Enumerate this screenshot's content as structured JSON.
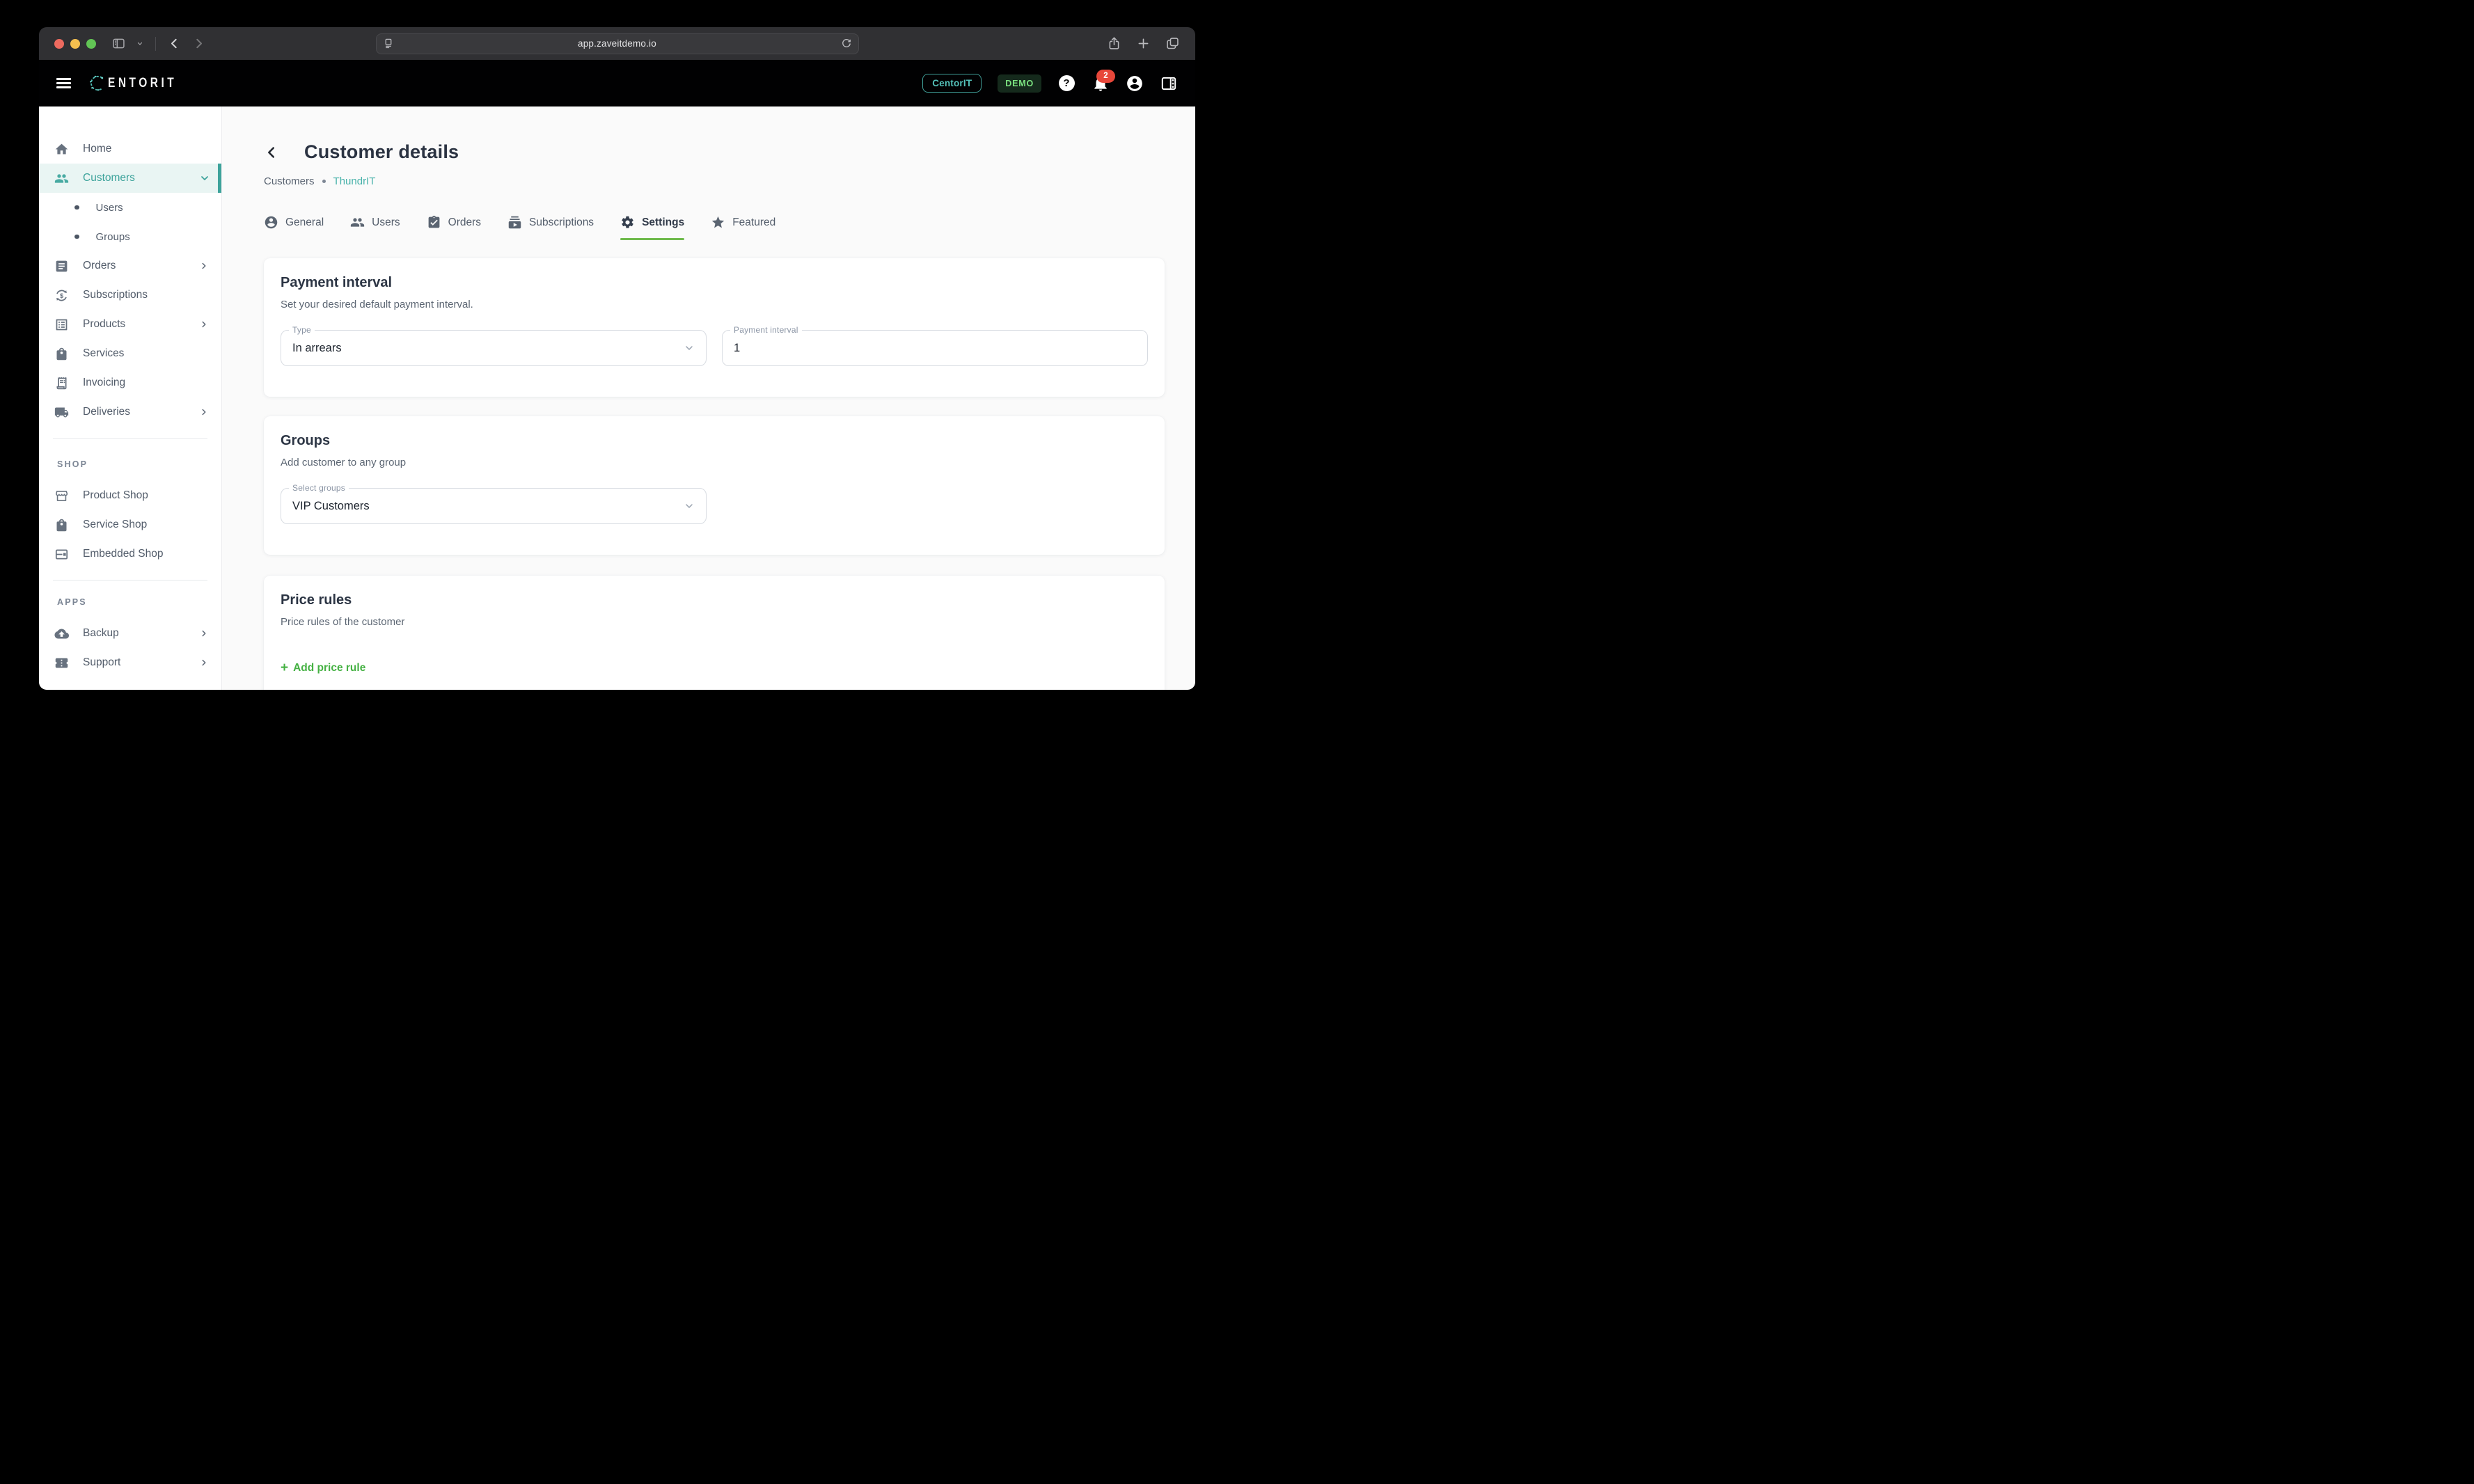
{
  "browser": {
    "url": "app.zaveitdemo.io"
  },
  "header": {
    "logo_mark_icon": "centorit-c-network-icon",
    "logo_text": "ENTORIT",
    "org_badge": "CentorIT",
    "env_badge": "DEMO",
    "help_icon": "help-icon",
    "bell_icon": "bell-icon",
    "notification_count": "2",
    "avatar_icon": "avatar-icon",
    "panel_icon": "panel-right-icon"
  },
  "sidebar": {
    "home": "Home",
    "customers": "Customers",
    "users": "Users",
    "groups": "Groups",
    "orders": "Orders",
    "subscriptions": "Subscriptions",
    "products": "Products",
    "services": "Services",
    "invoicing": "Invoicing",
    "deliveries": "Deliveries",
    "shop_label": "SHOP",
    "product_shop": "Product Shop",
    "service_shop": "Service Shop",
    "embedded_shop": "Embedded Shop",
    "apps_label": "APPS",
    "backup": "Backup",
    "support": "Support"
  },
  "page": {
    "title": "Customer details",
    "breadcrumb_parent": "Customers",
    "breadcrumb_current": "ThundrIT"
  },
  "tabs": [
    {
      "label": "General",
      "icon": "account-circle-icon",
      "active": false
    },
    {
      "label": "Users",
      "icon": "people-icon",
      "active": false
    },
    {
      "label": "Orders",
      "icon": "clipboard-check-icon",
      "active": false
    },
    {
      "label": "Subscriptions",
      "icon": "subscriptions-icon",
      "active": false
    },
    {
      "label": "Settings",
      "icon": "gear-icon",
      "active": true
    },
    {
      "label": "Featured",
      "icon": "star-icon",
      "active": false
    }
  ],
  "cards": {
    "payment_interval": {
      "title": "Payment interval",
      "description": "Set your desired default payment interval.",
      "type_label": "Type",
      "type_value": "In arrears",
      "interval_label": "Payment interval",
      "interval_value": "1"
    },
    "groups": {
      "title": "Groups",
      "description": "Add customer to any group",
      "select_label": "Select groups",
      "select_value": "VIP Customers"
    },
    "price_rules": {
      "title": "Price rules",
      "description": "Price rules of the customer",
      "add_plus": "+",
      "add_label": "Add price rule"
    }
  },
  "colors": {
    "accent_teal": "#3da39b",
    "accent_green": "#6fba4c",
    "link_green": "#45b143",
    "notification_red": "#e8473a",
    "demo_badge_green": "#7ce381"
  }
}
